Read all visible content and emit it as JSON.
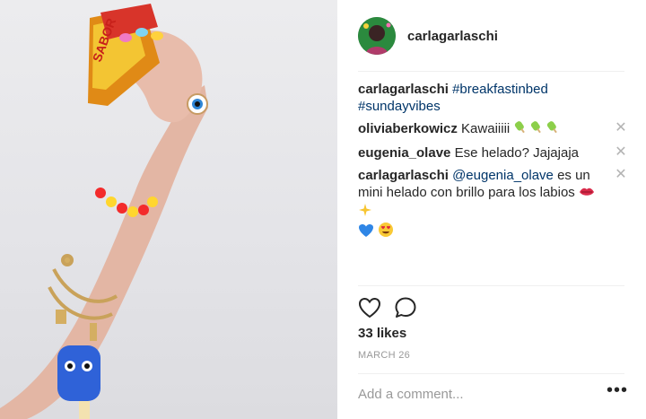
{
  "post": {
    "author": "carlagarlaschi"
  },
  "comments": [
    {
      "user": "carlagarlaschi",
      "segments": [
        {
          "type": "tag",
          "text": "#breakfastinbed"
        },
        {
          "type": "tag",
          "text": "#sundayvibes"
        }
      ],
      "removable": false
    },
    {
      "user": "oliviaberkowicz",
      "text": "Kawaiiiii",
      "emoji": [
        "popsicle-icon",
        "popsicle-icon",
        "popsicle-icon"
      ],
      "removable": true
    },
    {
      "user": "eugenia_olave",
      "text": "Ese helado? Jajajaja",
      "removable": true
    },
    {
      "user": "carlagarlaschi",
      "mention": "@eugenia_olave",
      "text": "es un mini helado con brillo para los labios",
      "emoji": [
        "lips-icon",
        "sparkles-icon",
        "blue-heart-icon",
        "heart-eyes-icon"
      ],
      "removable": true
    }
  ],
  "actions": {
    "like_icon": "heart-outline-icon",
    "comment_icon": "speech-bubble-icon"
  },
  "likes": "33 likes",
  "date": "MARCH 26",
  "add_comment": {
    "placeholder": "Add a comment...",
    "more_icon": "more-options-icon",
    "more_label": "•••"
  },
  "colors": {
    "link": "#003569",
    "muted": "#999999",
    "text": "#262626",
    "divider": "#efefef"
  }
}
